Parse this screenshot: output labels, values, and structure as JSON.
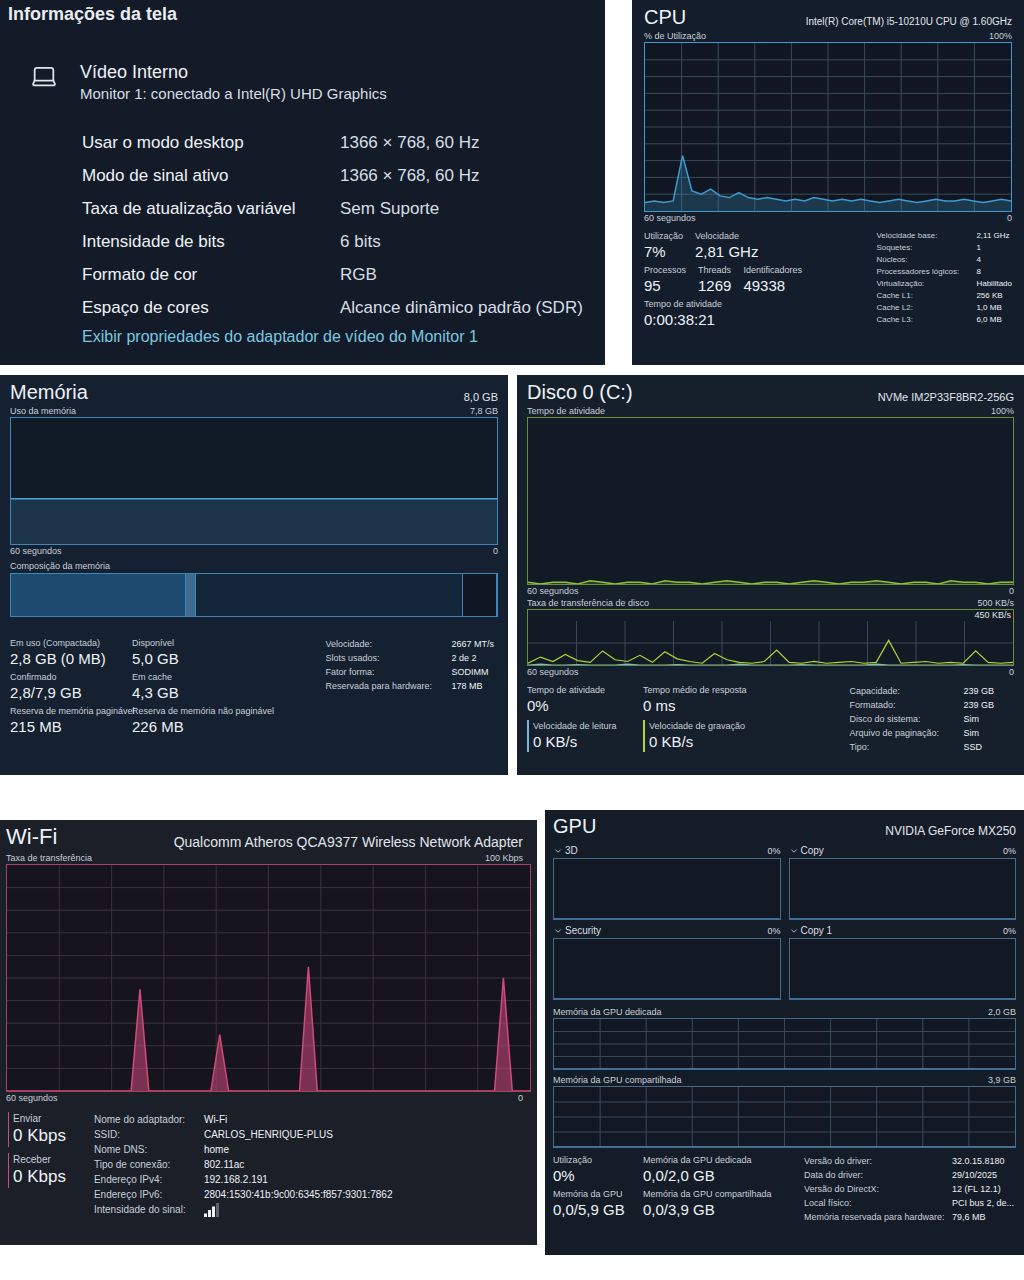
{
  "display_info": {
    "title": "Informações da tela",
    "device": "Vídeo Interno",
    "monitor": "Monitor 1: conectado a Intel(R) UHD Graphics",
    "rows": [
      {
        "label": "Usar o modo desktop",
        "value": "1366 × 768, 60 Hz"
      },
      {
        "label": "Modo de sinal ativo",
        "value": "1366 × 768, 60 Hz"
      },
      {
        "label": "Taxa de atualização variável",
        "value": "Sem Suporte"
      },
      {
        "label": "Intensidade de bits",
        "value": "6 bits"
      },
      {
        "label": "Formato de cor",
        "value": "RGB"
      },
      {
        "label": "Espaço de cores",
        "value": "Alcance dinâmico padrão (SDR)"
      }
    ],
    "link": "Exibir propriedades do adaptador de vídeo do Monitor 1"
  },
  "cpu": {
    "title": "CPU",
    "model": "Intel(R) Core(TM) i5-10210U CPU @ 1.60GHz",
    "axis_label": "% de Utilização",
    "axis_max": "100%",
    "axis_time": "60 segundos",
    "axis_min": "0",
    "max": 100,
    "series": [
      5,
      6,
      5,
      6,
      33,
      12,
      10,
      13,
      9,
      8,
      11,
      8,
      7,
      8,
      7,
      6,
      7,
      6,
      8,
      7,
      6,
      7,
      6,
      7,
      6,
      5,
      6,
      7,
      6,
      5,
      6,
      7,
      6,
      6,
      7,
      6,
      5,
      6,
      7,
      6
    ],
    "stat_rows": [
      [
        {
          "label": "Utilização",
          "value": "7%"
        },
        {
          "label": "Velocidade",
          "value": "2,81 GHz"
        }
      ],
      [
        {
          "label": "Processos",
          "value": "95"
        },
        {
          "label": "Threads",
          "value": "1269"
        },
        {
          "label": "Identificadores",
          "value": "49338"
        }
      ],
      [
        {
          "label": "Tempo de atividade",
          "value": "0:00:38:21"
        }
      ]
    ],
    "details": [
      {
        "label": "Velocidade base:",
        "value": "2,11 GHz"
      },
      {
        "label": "Soquetes:",
        "value": "1"
      },
      {
        "label": "Núcleos:",
        "value": "4"
      },
      {
        "label": "Processadores lógicos:",
        "value": "8"
      },
      {
        "label": "Virtualização:",
        "value": "Habilitado"
      },
      {
        "label": "Cache L1:",
        "value": "256 KB"
      },
      {
        "label": "Cache L2:",
        "value": "1,0 MB"
      },
      {
        "label": "Cache L3:",
        "value": "6,0 MB"
      }
    ]
  },
  "memory": {
    "title": "Memória",
    "total": "8,0 GB",
    "axis_label": "Uso da memória",
    "axis_max": "7,8 GB",
    "axis_time": "60 segundos",
    "axis_min": "0",
    "max": 7.8,
    "series": [
      2.8,
      2.8,
      2.8,
      2.8,
      2.8,
      2.8,
      2.8,
      2.8,
      2.8,
      2.8,
      2.8,
      2.8,
      2.8,
      2.8,
      2.8,
      2.8,
      2.8,
      2.8,
      2.8,
      2.8
    ],
    "composition_label": "Composição da memória",
    "composition": [
      {
        "kind": "in-use",
        "level": 0.36
      },
      {
        "kind": "modified",
        "level": 0.02
      },
      {
        "kind": "standby",
        "level": 0.55
      },
      {
        "kind": "free",
        "level": 0.07
      }
    ],
    "stat_rows": [
      [
        {
          "label": "Em uso (Compactada)",
          "value": "2,8 GB (0 MB)"
        },
        {
          "label": "Disponível",
          "value": "5,0 GB"
        }
      ],
      [
        {
          "label": "Confirmado",
          "value": "2,8/7,9 GB"
        },
        {
          "label": "Em cache",
          "value": "4,3 GB"
        }
      ],
      [
        {
          "label": "Reserva de memória paginável",
          "value": "215 MB"
        },
        {
          "label": "Reserva de memória não paginável",
          "value": "226 MB"
        }
      ]
    ],
    "details": [
      {
        "label": "Velocidade:",
        "value": "2667 MT/s"
      },
      {
        "label": "Slots usados:",
        "value": "2 de 2"
      },
      {
        "label": "Fator forma:",
        "value": "SODIMM"
      },
      {
        "label": "Reservada para hardware:",
        "value": "178 MB"
      }
    ]
  },
  "disk": {
    "title": "Disco 0 (C:)",
    "model": "NVMe IM2P33F8BR2-256G",
    "axis_label": "Tempo de atividade",
    "axis_max": "100%",
    "axis_time": "60 segundos",
    "axis_min": "0",
    "max": 100,
    "series": [
      1,
      0,
      1,
      1,
      0,
      2,
      1,
      0,
      1,
      1,
      0,
      2,
      1,
      1,
      0,
      1,
      2,
      1,
      0,
      1,
      1,
      0,
      1,
      2,
      1,
      0,
      1,
      1,
      2,
      1,
      0,
      1,
      1,
      0,
      2,
      1,
      1,
      0,
      1,
      1
    ],
    "transfer_label": "Taxa de transferência de disco",
    "transfer_max_label": "500 KB/s",
    "transfer_mark": "450 KB/s",
    "transfer_time": "60 segundos",
    "transfer_min": "0",
    "transfer_max": 500,
    "transfer_series": [
      {
        "name": "read",
        "color": "#7fb3d5",
        "values": [
          0,
          10,
          0,
          0,
          5,
          0,
          0,
          0,
          10,
          0,
          0,
          0,
          5,
          0,
          0,
          0,
          0,
          10,
          0,
          0,
          0,
          0,
          5,
          0,
          0,
          0,
          0,
          0,
          10,
          0,
          0,
          0,
          0,
          0,
          0,
          5,
          0,
          0,
          0,
          0
        ]
      },
      {
        "name": "write",
        "color": "#b5d334",
        "values": [
          20,
          90,
          40,
          120,
          50,
          30,
          160,
          60,
          40,
          110,
          30,
          150,
          70,
          40,
          20,
          130,
          60,
          30,
          20,
          40,
          170,
          30,
          20,
          40,
          20,
          30,
          40,
          20,
          30,
          280,
          20,
          30,
          40,
          20,
          30,
          20,
          160,
          30,
          20,
          30
        ]
      }
    ],
    "stat_rows": [
      [
        {
          "label": "Tempo de atividade",
          "value": "0%"
        },
        {
          "label": "Tempo médio de resposta",
          "value": "0 ms"
        }
      ],
      [
        {
          "label": "Velocidade de leitura",
          "value": "0 KB/s",
          "color": "#7fb3d5"
        },
        {
          "label": "Velocidade de gravação",
          "value": "0 KB/s",
          "color": "#b5d334"
        }
      ]
    ],
    "details": [
      {
        "label": "Capacidade:",
        "value": "239 GB"
      },
      {
        "label": "Formatado:",
        "value": "239 GB"
      },
      {
        "label": "Disco do sistema:",
        "value": "Sim"
      },
      {
        "label": "Arquivo de paginação:",
        "value": "Sim"
      },
      {
        "label": "Tipo:",
        "value": "SSD"
      }
    ]
  },
  "wifi": {
    "title": "Wi-Fi",
    "adapter": "Qualcomm Atheros QCA9377 Wireless Network Adapter",
    "axis_label": "Taxa de transferência",
    "axis_max": "100 Kbps",
    "axis_time": "60 segundos",
    "axis_min": "0",
    "max": 100,
    "series": [
      0,
      0,
      0,
      0,
      0,
      0,
      0,
      0,
      0,
      0,
      0,
      0,
      0,
      0,
      0,
      45,
      0,
      0,
      0,
      0,
      0,
      0,
      0,
      0,
      25,
      0,
      0,
      0,
      0,
      0,
      0,
      0,
      0,
      0,
      55,
      0,
      0,
      0,
      0,
      0,
      0,
      0,
      0,
      0,
      0,
      0,
      0,
      0,
      0,
      0,
      0,
      0,
      0,
      0,
      0,
      0,
      50,
      0,
      0,
      0
    ],
    "stats": [
      {
        "label": "Enviar",
        "value": "0 Kbps"
      },
      {
        "label": "Receber",
        "value": "0 Kbps"
      }
    ],
    "details": [
      {
        "label": "Nome do adaptador:",
        "value": "Wi-Fi"
      },
      {
        "label": "SSID:",
        "value": "CARLOS_HENRIQUE-PLUS"
      },
      {
        "label": "Nome DNS:",
        "value": "home"
      },
      {
        "label": "Tipo de conexão:",
        "value": "802.11ac"
      },
      {
        "label": "Endereço IPv4:",
        "value": "192.168.2.191"
      },
      {
        "label": "Endereço IPv6:",
        "value": "2804:1530:41b:9c00:6345:f857:9301:7862"
      }
    ],
    "signal_label": "Intensidade do sinal:",
    "signal_level": 0.75
  },
  "gpu": {
    "title": "GPU",
    "model": "NVIDIA GeForce MX250",
    "engines": [
      {
        "name": "3D",
        "value": "0%",
        "series": [
          0,
          0,
          0,
          0,
          0,
          0,
          0,
          0,
          0,
          0
        ]
      },
      {
        "name": "Copy",
        "value": "0%",
        "series": [
          0,
          0,
          0,
          0,
          0,
          0,
          0,
          0,
          0,
          0
        ]
      },
      {
        "name": "Security",
        "value": "0%",
        "series": [
          0,
          0,
          0,
          0,
          0,
          0,
          0,
          0,
          0,
          0
        ]
      },
      {
        "name": "Copy 1",
        "value": "0%",
        "series": [
          0,
          0,
          0,
          0,
          0,
          0,
          0,
          0,
          0,
          0
        ]
      }
    ],
    "dedicated": {
      "label": "Memória da GPU dedicada",
      "max": "2,0 GB",
      "series": [
        0,
        0,
        0,
        0,
        0,
        0,
        0,
        0,
        0,
        0
      ]
    },
    "shared": {
      "label": "Memória da GPU compartilhada",
      "max": "3,9 GB",
      "series": [
        0,
        0,
        0,
        0,
        0,
        0,
        0,
        0,
        0,
        0
      ]
    },
    "stat_rows": [
      [
        {
          "label": "Utilização",
          "value": "0%"
        },
        {
          "label": "Memória da GPU dedicada",
          "value": "0,0/2,0 GB"
        }
      ],
      [
        {
          "label": "Memória da GPU",
          "value": "0,0/5,9 GB"
        },
        {
          "label": "Memória da GPU compartilhada",
          "value": "0,0/3,9 GB"
        }
      ]
    ],
    "details": [
      {
        "label": "Versão do driver:",
        "value": "32.0.15.8180"
      },
      {
        "label": "Data do driver:",
        "value": "29/10/2025"
      },
      {
        "label": "Versão do DirectX:",
        "value": "12 (FL 12.1)"
      },
      {
        "label": "Local físico:",
        "value": "PCI bus 2, de..."
      },
      {
        "label": "Memória reservada para hardware:",
        "value": "79,6 MB"
      }
    ]
  }
}
